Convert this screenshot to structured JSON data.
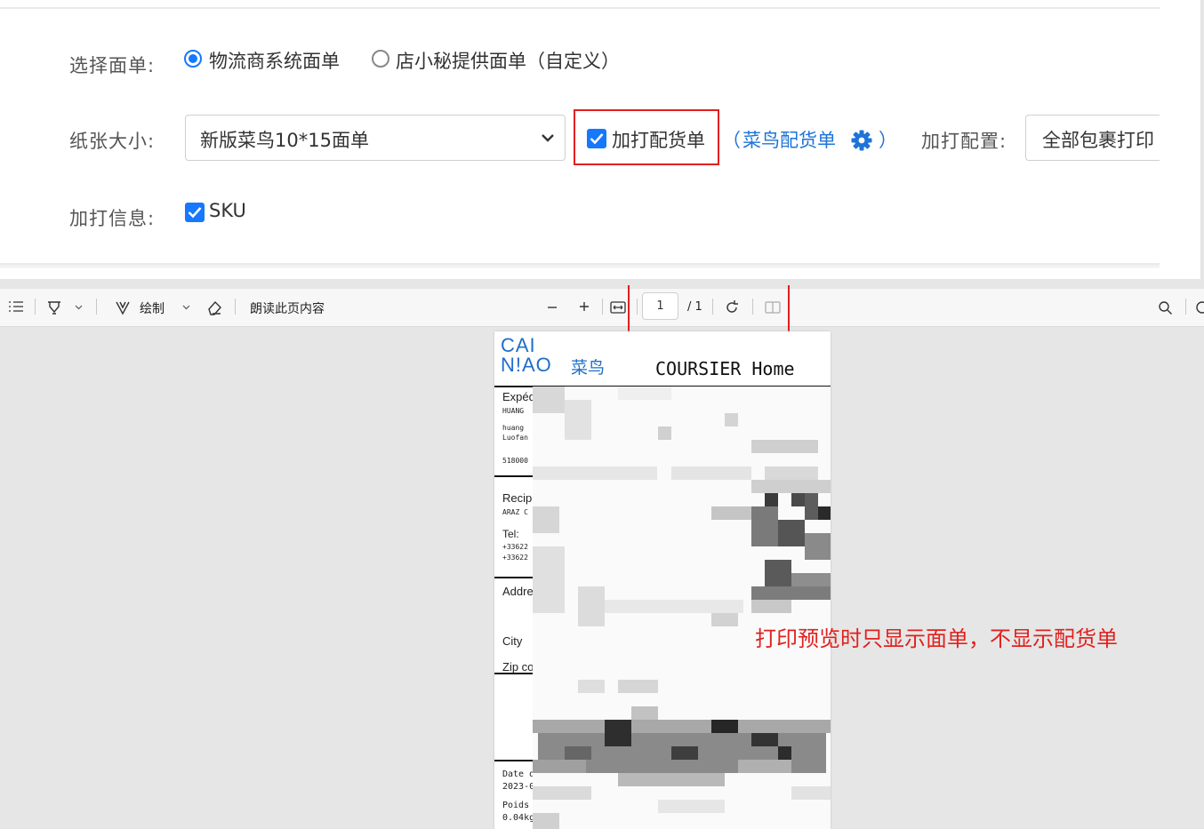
{
  "form": {
    "select_form_label": "选择面单:",
    "option_logistics": "物流商系统面单",
    "option_custom": "店小秘提供面单（自定义）",
    "paper_size_label": "纸张大小:",
    "paper_size_value": "新版菜鸟10*15面单",
    "extra_packing_list": "加打配货单",
    "paren_open": "（",
    "cainiao_packing_link": "菜鸟配货单",
    "paren_close": "）",
    "extra_config_label": "加打配置:",
    "extra_config_value": "全部包裹打印",
    "extra_info_label": "加打信息:",
    "sku_label": "SKU"
  },
  "toolbar": {
    "draw_label": "绘制",
    "read_aloud_label": "朗读此页内容",
    "page_number": "1",
    "page_total": "/ 1"
  },
  "document": {
    "logo_line1": "CAI",
    "logo_line2": "N!AO",
    "logo_cn": "菜鸟",
    "service": "COURSIER Home",
    "sender_label": "Expéd",
    "sender_name": "HUANG",
    "sender_line1": "huang",
    "sender_line2": "Luofan",
    "sender_zip": "518000",
    "recipient_label": "Recip",
    "recipient_name": "ARAZ C",
    "tel_label": "Tel:",
    "tel_1": "+33622",
    "tel_2": "+33622",
    "address_label": "Addre",
    "city_label": "City",
    "zip_label": "Zip co",
    "date_label": "Date d",
    "date_value": "2023-0",
    "weight_label": "Poids",
    "weight_value": "0.04kg"
  },
  "annotation": "打印预览时只显示面单，不显示配货单",
  "colors": {
    "accent": "#1677ff",
    "link": "#1e73d8",
    "highlight_red": "#e01f1f"
  }
}
